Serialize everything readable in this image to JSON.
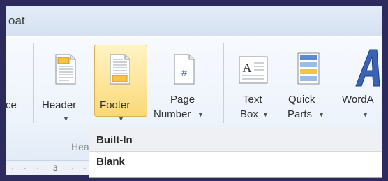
{
  "titlebar": {
    "text": "oat"
  },
  "ribbon": {
    "partial_left_label": "ce",
    "buttons": [
      {
        "name": "header",
        "label": "Header"
      },
      {
        "name": "footer",
        "label": "Footer"
      },
      {
        "name": "page-number",
        "label_line1": "Page",
        "label_line2": "Number"
      },
      {
        "name": "text-box",
        "label_line1": "Text",
        "label_line2": "Box"
      },
      {
        "name": "quick-parts",
        "label_line1": "Quick",
        "label_line2": "Parts"
      },
      {
        "name": "wordart",
        "label": "WordA"
      }
    ],
    "group_label": "Hea",
    "page_number_icon_glyph": "#",
    "textbox_icon_glyph": "A"
  },
  "ruler": {
    "mark": "3"
  },
  "dropdown": {
    "header": "Built-In",
    "items": [
      "Blank"
    ]
  },
  "colors": {
    "outer_frame": "#2d2b5e",
    "footer_highlight": "#fde59a",
    "wordart_blue": "#3a63b8"
  }
}
